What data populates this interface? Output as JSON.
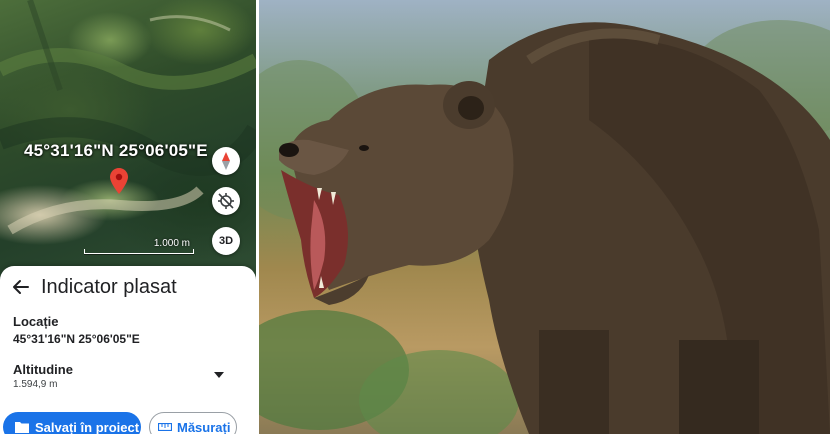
{
  "map": {
    "coordinates_overlay": "45°31'16\"N 25°06'05\"E",
    "scale_label": "1.000 m",
    "view_3d_label": "3D",
    "icons": [
      "compass-icon",
      "location-off-icon",
      "map-pin-icon"
    ]
  },
  "sheet": {
    "title": "Indicator plasat",
    "location_label": "Locație",
    "location_value": "45°31'16\"N 25°06'05\"E",
    "altitude_label": "Altitudine",
    "altitude_value": "1.594,9 m",
    "save_button": "Salvați în proiect",
    "measure_button": "Măsurați"
  },
  "colors": {
    "accent": "#1a73e8",
    "pin": "#ea4335",
    "text": "#202124"
  },
  "photo": {
    "subject": "bear-photo"
  }
}
